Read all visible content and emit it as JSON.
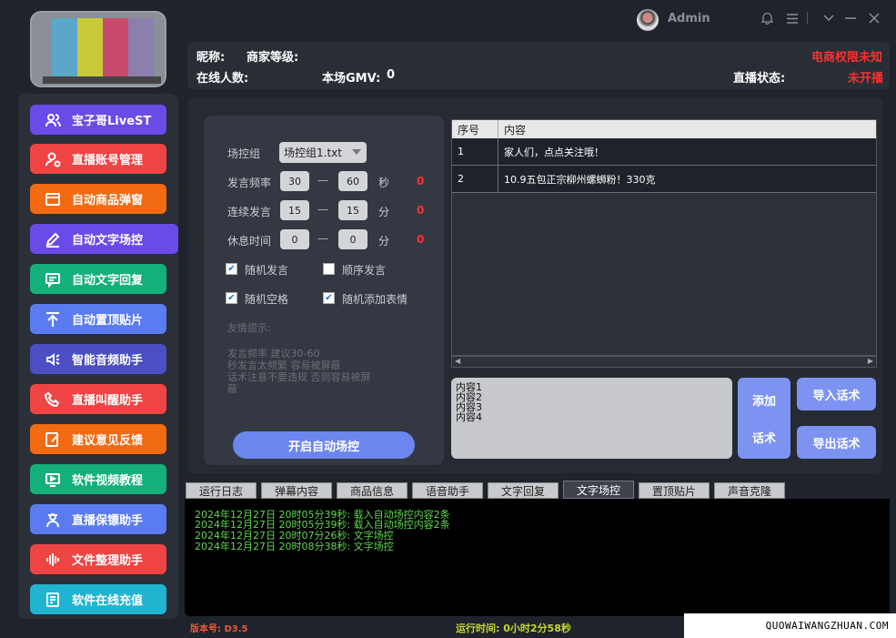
{
  "topbar": {
    "user": "Admin",
    "bell": "bell-icon",
    "menu": "menu-icon",
    "collapse": "chevron-down-icon",
    "minimize": "minimize-icon",
    "close": "close-icon"
  },
  "logo": {
    "colors": [
      "#5aa7c9",
      "#c9c93a",
      "#c94b6b",
      "#8a7fae"
    ]
  },
  "sidebar": {
    "items": [
      {
        "label": "宝子哥LiveST",
        "color": "#6a4be8",
        "icon": "users-icon"
      },
      {
        "label": "直播账号管理",
        "color": "#ef4444",
        "icon": "user-settings-icon"
      },
      {
        "label": "自动商品弹窗",
        "color": "#f26a12",
        "icon": "window-icon"
      },
      {
        "label": "自动文字场控",
        "color": "#6a4be8",
        "icon": "edit-icon"
      },
      {
        "label": "自动文字回复",
        "color": "#15b07a",
        "icon": "message-icon"
      },
      {
        "label": "自动置顶贴片",
        "color": "#5b7cf0",
        "icon": "pin-top-icon"
      },
      {
        "label": "智能音频助手",
        "color": "#4a4fc4",
        "icon": "speaker-icon"
      },
      {
        "label": "直播叫醒助手",
        "color": "#ef4444",
        "icon": "phone-icon"
      },
      {
        "label": "建议意见反馈",
        "color": "#f26a12",
        "icon": "feedback-icon"
      },
      {
        "label": "软件视频教程",
        "color": "#15b07a",
        "icon": "video-icon"
      },
      {
        "label": "直播保镖助手",
        "color": "#5b7cf0",
        "icon": "bodyguard-icon"
      },
      {
        "label": "文件整理助手",
        "color": "#ef4444",
        "icon": "audio-wave-icon"
      },
      {
        "label": "软件在线充值",
        "color": "#20b4d0",
        "icon": "recharge-icon"
      }
    ]
  },
  "header": {
    "nickname_label": "昵称:",
    "level_label": "商家等级:",
    "permission": "电商权限未知",
    "online_label": "在线人数:",
    "gmv_label": "本场GMV:",
    "gmv_value": "0",
    "live_status_label": "直播状态:",
    "live_status_value": "未开播"
  },
  "control": {
    "group_label": "场控组",
    "group_value": "场控组1.txt",
    "freq_label": "发言频率",
    "freq_min": "30",
    "freq_max": "60",
    "freq_unit": "秒",
    "freq_count": "0",
    "cont_label": "连续发言",
    "cont_min": "15",
    "cont_max": "15",
    "cont_unit": "分",
    "cont_count": "0",
    "rest_label": "休息时间",
    "rest_min": "0",
    "rest_max": "0",
    "rest_unit": "分",
    "rest_count": "0",
    "dash": "一",
    "random_speak": "随机发言",
    "sequential_speak": "顺序发言",
    "random_space": "随机空格",
    "random_emoji": "随机添加表情",
    "tips_title": "友情提示:",
    "tips_1": "发言频率 建议30-60",
    "tips_2": "秒发言太频繁 容易被屏蔽",
    "tips_3": "话术注意不要违规 否则容易被屏",
    "tips_4": "蔽",
    "start_button": "开启自动场控"
  },
  "table": {
    "headers": [
      "序号",
      "内容"
    ],
    "rows": [
      {
        "no": "1",
        "content": "家人们，点点关注哦！"
      },
      {
        "no": "2",
        "content": "10.9五包正宗柳州螺蛳粉！330克"
      }
    ]
  },
  "editor": {
    "lines": [
      "内容1",
      "内容2",
      "内容3",
      "内容4"
    ],
    "add_button_1": "添加",
    "add_button_2": "话术",
    "import_button": "导入话术",
    "export_button": "导出话术"
  },
  "tabs": [
    "运行日志",
    "弹幕内容",
    "商品信息",
    "语音助手",
    "文字回复",
    "文字场控",
    "置顶贴片",
    "声音克隆"
  ],
  "active_tab": "文字场控",
  "log": [
    "2024年12月27日 20时05分39秒: 载入自动场控内容2条",
    "2024年12月27日 20时05分39秒: 载入自动场控内容2条",
    "2024年12月27日 20时07分26秒: 文字场控",
    "2024年12月27日 20时08分38秒: 文字场控"
  ],
  "footer": {
    "version": "版本号: D3.5",
    "runtime": "运行时间: 0小时2分58秒",
    "watermark": "QUOWAIWANGZHUAN.COM"
  }
}
